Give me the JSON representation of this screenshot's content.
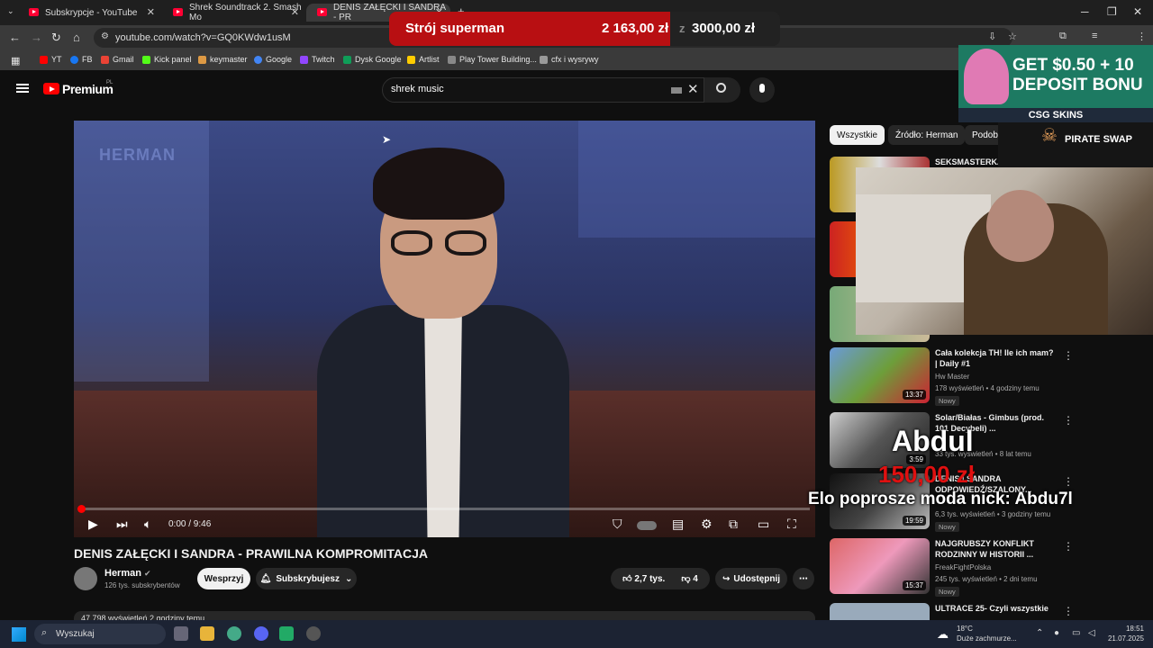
{
  "browser": {
    "tabs": [
      {
        "label": "Subskrypcje - YouTube"
      },
      {
        "label": "Shrek Soundtrack 2. Smash Mo"
      },
      {
        "label": "DENIS ZAŁĘCKI I SANDRA - PR"
      }
    ],
    "new_tab": "+",
    "url": "youtube.com/watch?v=GQ0KWdw1usM",
    "bookmarks": [
      "YT",
      "FB",
      "Gmail",
      "Kick panel",
      "keymaster",
      "Google",
      "Twitch",
      "Dysk Google",
      "Artlist",
      "Play Tower Building...",
      "cfx i wysrywy"
    ]
  },
  "youtube": {
    "logo_text": "Premium",
    "logo_region": "PL",
    "search_query": "shrek music",
    "video": {
      "watermark": "HERMAN",
      "time": "0:00 / 9:46",
      "progress": 0.0,
      "title": "DENIS ZAŁĘCKI I SANDRA - PRAWILNA KOMPROMITACJA",
      "channel": "Herman",
      "subscribers": "126 tys. subskrybentów",
      "support_label": "Wesprzyj",
      "subscribed_label": "Subskrybujesz",
      "likes": "2,7 tys.",
      "dislikes": "4",
      "share_label": "Udostępnij",
      "desc_preview": "47 798 wyświetleń  2 godziny temu"
    },
    "chips": [
      "Wszystkie",
      "Źródło: Herman",
      "Podobne"
    ],
    "recommended": [
      {
        "title": "SEKSMASTERKA",
        "channel": "",
        "meta": "",
        "duration": "",
        "badge": ""
      },
      {
        "title": "",
        "channel": "",
        "meta": "",
        "duration": "",
        "badge": ""
      },
      {
        "title": "",
        "channel": "",
        "meta": "",
        "duration": "",
        "badge": ""
      },
      {
        "title": "Cała kolekcja TH! Ile ich mam? | Daily #1",
        "channel": "Hw Master",
        "meta": "178 wyświetleń • 4 godziny temu",
        "duration": "13:37",
        "badge": "Nowy"
      },
      {
        "title": "Solar/Białas - Gimbus (prod. 101 Decybeli) ...",
        "channel": "",
        "meta": "33 tys. wyświetleń • 8 lat temu",
        "duration": "3:59",
        "badge": ""
      },
      {
        "title": "DENIS I SANDRA ODPOWIEDŹ/SZALONY...",
        "channel": "",
        "meta": "6,3 tys. wyświetleń • 3 godziny temu",
        "duration": "19:59",
        "badge": "Nowy"
      },
      {
        "title": "NAJGRUBSZY KONFLIKT RODZINNY W HISTORII ...",
        "channel": "FreakFightPolska",
        "meta": "245 tys. wyświetleń • 2 dni temu",
        "duration": "15:37",
        "badge": "Nowy"
      },
      {
        "title": "ULTRACE 25- Czyli wszystkie",
        "channel": "",
        "meta": "",
        "duration": "",
        "badge": ""
      }
    ]
  },
  "overlay": {
    "goal_name": "Strój superman",
    "goal_current": "2 163,00 zł",
    "goal_sep": "z",
    "goal_target": "3000,00 zł",
    "goal_progress": 0.72,
    "ad_text": "GET $0.50 + 10 DEPOSIT BONU",
    "ad_brand": "CSG SKINS",
    "ad2_text": "PIRATE SWAP",
    "alert_name": "Abdul",
    "alert_amount": "150,00 zł",
    "alert_message": "Elo poprosze moda nick: Abdu7l"
  },
  "taskbar": {
    "search_placeholder": "Wyszukaj",
    "weather_temp": "18°C",
    "weather_desc": "Duże zachmurze...",
    "time": "18:51",
    "date": "21.07.2025"
  },
  "colors": {
    "yt_red": "#ff0000",
    "goal_fill": "#b80f12",
    "alert_red": "#e01010"
  }
}
